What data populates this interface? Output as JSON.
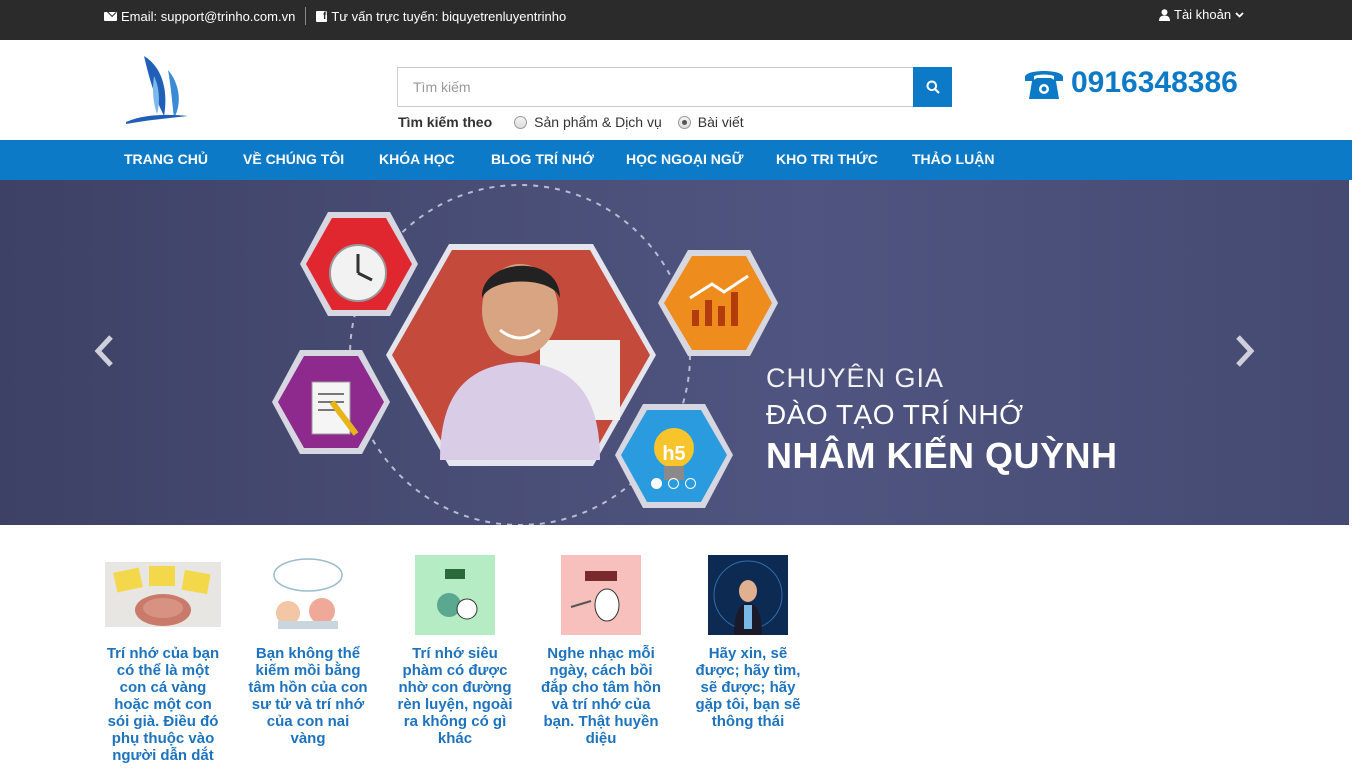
{
  "topbar": {
    "email": "Email: support@trinho.com.vn",
    "facebook": "Tư vấn trực tuyến: biquyetrenluyentrinho",
    "account": "Tài khoản"
  },
  "search": {
    "placeholder": "Tìm kiếm",
    "label": "Tìm kiếm theo",
    "options": [
      {
        "label": "Sản phẩm & Dịch vụ",
        "selected": false
      },
      {
        "label": "Bài viết",
        "selected": true
      }
    ]
  },
  "phone": "0916348386",
  "nav": [
    "TRANG CHỦ",
    "VỀ CHÚNG TÔI",
    "KHÓA HỌC",
    "BLOG TRÍ NHỚ",
    "HỌC NGOẠI NGỮ",
    "KHO TRI THỨC",
    "THẢO LUẬN"
  ],
  "banner": {
    "line1": "CHUYÊN GIA",
    "line2": "ĐÀO TẠO TRÍ NHỚ",
    "line3": "NHÂM KIẾN QUỲNH",
    "icon_badge": "h5",
    "active_slide": 1,
    "slide_count": 3
  },
  "articles": [
    "Trí nhớ của bạn có thể là một con cá vàng hoặc một con sói già. Điều đó phụ thuộc vào người dẫn dắt",
    "Bạn không thể kiếm mồi bằng tâm hồn của con sư tử và trí nhớ của con nai vàng",
    "Trí nhớ siêu phàm có được nhờ con đường rèn luyện, ngoài ra không có gì khác",
    "Nghe nhạc mỗi ngày, cách bồi đắp cho tâm hồn và trí nhớ của bạn. Thật huyền diệu",
    "Hãy xin, sẽ được; hãy tìm, sẽ được; hãy gặp tôi, bạn sẽ thông thái"
  ],
  "colors": {
    "brand": "#0d7ac8",
    "topbar": "#2b2b2b",
    "banner": "#4a4f78"
  }
}
